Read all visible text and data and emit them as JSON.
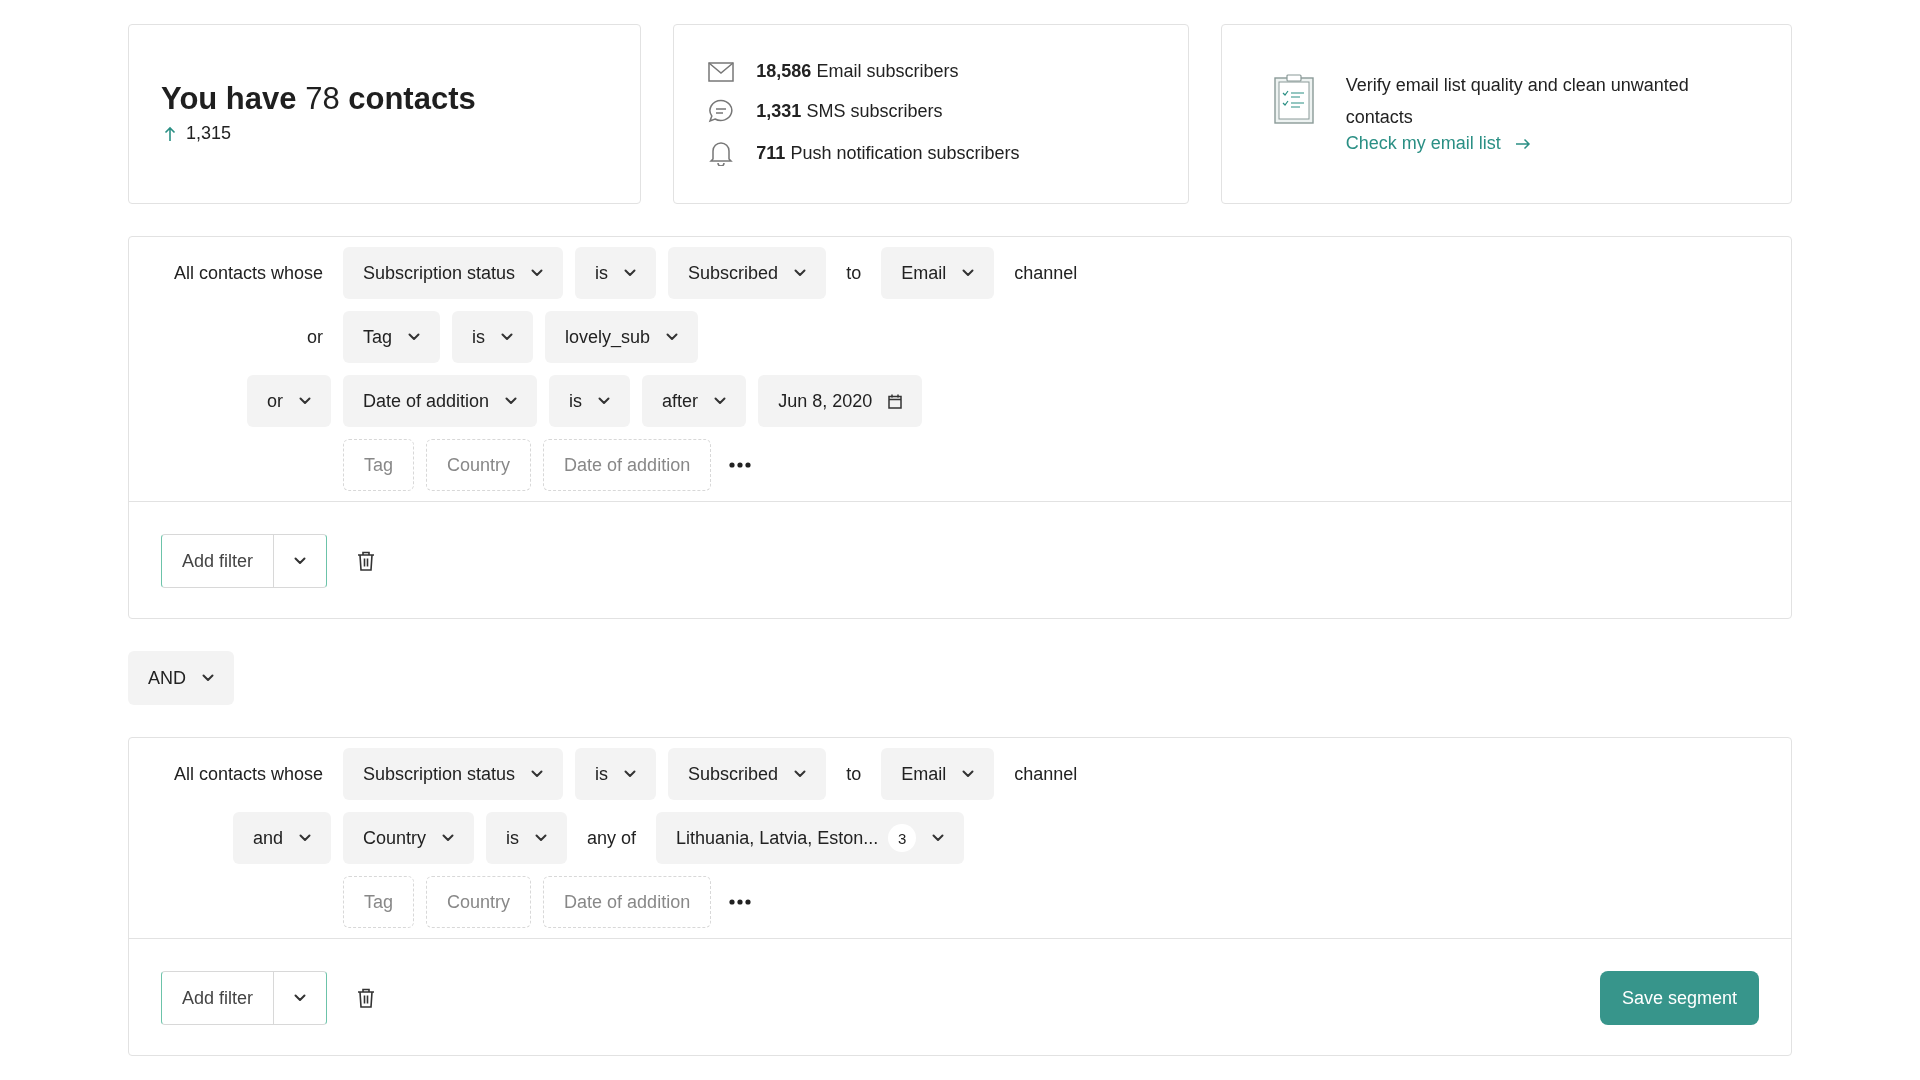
{
  "summary": {
    "title_prefix": "You have",
    "count": "78",
    "title_suffix": "contacts",
    "growth": "1,315"
  },
  "subscribers": [
    {
      "kind": "email",
      "count": "18,586",
      "label": "Email subscribers"
    },
    {
      "kind": "sms",
      "count": "1,331",
      "label": "SMS subscribers"
    },
    {
      "kind": "push",
      "count": "711",
      "label": "Push notification subscribers"
    }
  ],
  "verify": {
    "text": "Verify email list quality and clean unwanted contacts",
    "link": "Check my email list"
  },
  "groups": [
    {
      "rows": [
        {
          "lead": {
            "kind": "text",
            "text": "All contacts whose"
          },
          "parts": [
            {
              "kind": "select",
              "text": "Subscription status"
            },
            {
              "kind": "select",
              "text": "is"
            },
            {
              "kind": "select",
              "text": "Subscribed"
            },
            {
              "kind": "text",
              "text": "to"
            },
            {
              "kind": "select",
              "text": "Email"
            },
            {
              "kind": "text",
              "text": "channel"
            }
          ]
        },
        {
          "lead": {
            "kind": "text",
            "text": "or"
          },
          "parts": [
            {
              "kind": "select",
              "text": "Tag"
            },
            {
              "kind": "select",
              "text": "is"
            },
            {
              "kind": "select",
              "text": "lovely_sub"
            }
          ]
        },
        {
          "lead": {
            "kind": "select",
            "text": "or"
          },
          "parts": [
            {
              "kind": "select",
              "text": "Date of addition"
            },
            {
              "kind": "select",
              "text": "is"
            },
            {
              "kind": "select",
              "text": "after"
            },
            {
              "kind": "date",
              "text": "Jun 8, 2020"
            }
          ]
        }
      ],
      "quick_filters": [
        "Tag",
        "Country",
        "Date of addition"
      ],
      "add_filter": "Add filter"
    },
    {
      "rows": [
        {
          "lead": {
            "kind": "text",
            "text": "All contacts whose"
          },
          "parts": [
            {
              "kind": "select",
              "text": "Subscription status"
            },
            {
              "kind": "select",
              "text": "is"
            },
            {
              "kind": "select",
              "text": "Subscribed"
            },
            {
              "kind": "text",
              "text": "to"
            },
            {
              "kind": "select",
              "text": "Email"
            },
            {
              "kind": "text",
              "text": "channel"
            }
          ]
        },
        {
          "lead": {
            "kind": "select",
            "text": "and"
          },
          "parts": [
            {
              "kind": "select",
              "text": "Country"
            },
            {
              "kind": "select",
              "text": "is"
            },
            {
              "kind": "text",
              "text": "any of"
            },
            {
              "kind": "multi",
              "text": "Lithuania, Latvia, Eston...",
              "count": "3"
            }
          ]
        }
      ],
      "quick_filters": [
        "Tag",
        "Country",
        "Date of addition"
      ],
      "add_filter": "Add filter",
      "save_button": "Save segment"
    }
  ],
  "join": "AND"
}
